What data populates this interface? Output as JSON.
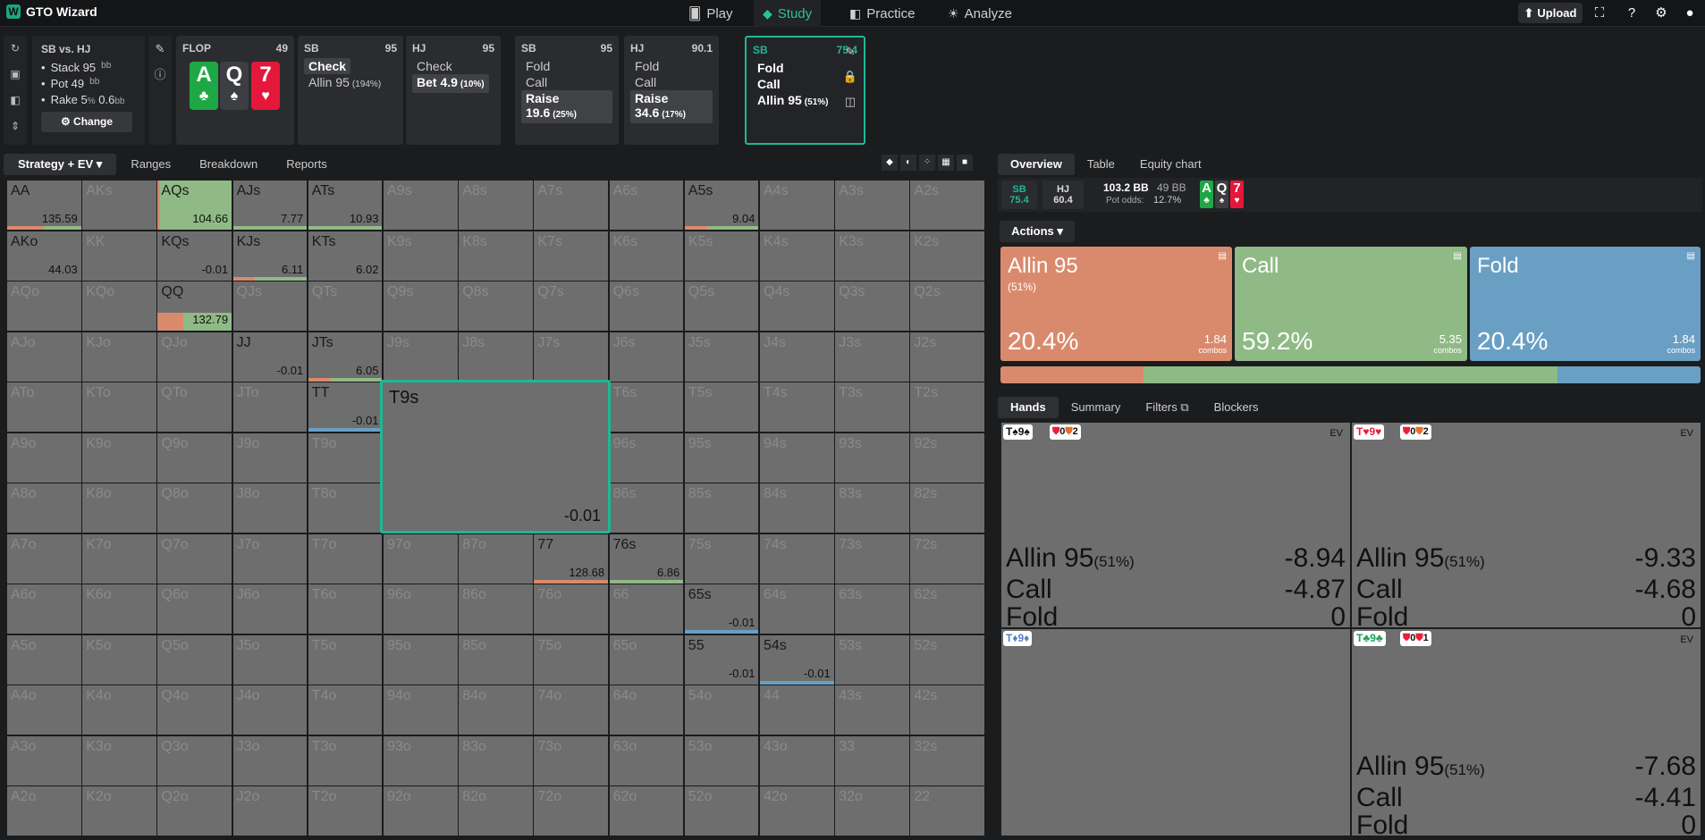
{
  "app": {
    "name": "GTO Wizard",
    "logo": "W"
  },
  "nav": [
    {
      "label": "Play",
      "icon": "cards-icon"
    },
    {
      "label": "Study",
      "icon": "graduation-cap-icon"
    },
    {
      "label": "Practice",
      "icon": "gamepad-icon"
    },
    {
      "label": "Analyze",
      "icon": "bulb-icon"
    }
  ],
  "upload_label": "Upload",
  "info": {
    "title": "SB vs. HJ",
    "stack": "Stack 95",
    "stack_unit": "bb",
    "pot": "Pot 49",
    "pot_unit": "bb",
    "rake": "Rake 5",
    "rake_pct": "%",
    "rake_val": "0.6",
    "rake_unit": "bb",
    "change": "Change"
  },
  "flop": {
    "label": "FLOP",
    "pot": "49",
    "cards": [
      {
        "rank": "A",
        "suit": "♣",
        "color": "#1ea845"
      },
      {
        "rank": "Q",
        "suit": "♠",
        "color": "#3d3e42"
      },
      {
        "rank": "7",
        "suit": "♥",
        "color": "#e5173a"
      }
    ]
  },
  "actions": [
    {
      "pos": "SB",
      "val": "95",
      "opts": [
        {
          "t": "Check",
          "p": "",
          "sel": true
        },
        {
          "t": "Allin 95",
          "p": "(194%)",
          "sel": false
        }
      ]
    },
    {
      "pos": "HJ",
      "val": "95",
      "opts": [
        {
          "t": "Check",
          "p": "",
          "sel": false
        },
        {
          "t": "Bet 4.9",
          "p": "(10%)",
          "sel": true
        }
      ]
    },
    {
      "pos": "SB",
      "val": "95",
      "opts": [
        {
          "t": "Fold",
          "p": "",
          "sel": false
        },
        {
          "t": "Call",
          "p": "",
          "sel": false
        },
        {
          "t": "Raise 19.6",
          "p": "(25%)",
          "sel": true
        }
      ]
    },
    {
      "pos": "HJ",
      "val": "90.1",
      "opts": [
        {
          "t": "Fold",
          "p": "",
          "sel": false
        },
        {
          "t": "Call",
          "p": "",
          "sel": false
        },
        {
          "t": "Raise 34.6",
          "p": "(17%)",
          "sel": true
        }
      ]
    },
    {
      "pos": "SB",
      "val": "75.4",
      "opts": [
        {
          "t": "Fold",
          "p": "",
          "sel": false
        },
        {
          "t": "Call",
          "p": "",
          "sel": false
        },
        {
          "t": "Allin 95",
          "p": "(51%)",
          "sel": false
        }
      ]
    }
  ],
  "left_tabs": [
    "Strategy + EV",
    "Ranges",
    "Breakdown",
    "Reports"
  ],
  "right_tabs": [
    "Overview",
    "Table",
    "Equity chart"
  ],
  "pos_summary": {
    "sb": "SB",
    "sb_val": "75.4",
    "hj": "HJ",
    "hj_val": "60.4",
    "pot": "103.2 BB",
    "pot2": "49 BB",
    "odds_label": "Pot odds:",
    "odds": "12.7%"
  },
  "actions_label": "Actions",
  "action_boxes": [
    {
      "name": "Allin 95",
      "sub": "(51%)",
      "pct": "20.4%",
      "combos": "1.84",
      "combos_label": "combos",
      "color": "#da8a6c"
    },
    {
      "name": "Call",
      "sub": "",
      "pct": "59.2%",
      "combos": "5.35",
      "combos_label": "combos",
      "color": "#8fba86"
    },
    {
      "name": "Fold",
      "sub": "",
      "pct": "20.4%",
      "combos": "1.84",
      "combos_label": "combos",
      "color": "#6a9fc4"
    }
  ],
  "freq": [
    {
      "f": 0.204,
      "color": "#da8a6c"
    },
    {
      "f": 0.592,
      "color": "#8fba86"
    },
    {
      "f": 0.204,
      "color": "#6a9fc4"
    }
  ],
  "hand_tabs": [
    "Hands",
    "Summary",
    "Filters",
    "Blockers"
  ],
  "hand_cells": [
    {
      "combo": [
        [
          "T",
          "♠",
          "#111"
        ],
        [
          "9",
          "♠",
          "#111"
        ]
      ],
      "blockers": [
        [
          "0",
          "#e8203a"
        ],
        [
          "2",
          "#e8702a"
        ]
      ],
      "ev": "EV",
      "rows": [
        [
          "Allin 95",
          "(51%)",
          "-8.94"
        ],
        [
          "Call",
          "",
          "-4.87"
        ],
        [
          "Fold",
          "",
          "0"
        ]
      ]
    },
    {
      "combo": [
        [
          "T",
          "♥",
          "#e8203a"
        ],
        [
          "9",
          "♥",
          "#e8203a"
        ]
      ],
      "blockers": [
        [
          "0",
          "#e8203a"
        ],
        [
          "2",
          "#e8702a"
        ]
      ],
      "ev": "EV",
      "rows": [
        [
          "Allin 95",
          "(51%)",
          "-9.33"
        ],
        [
          "Call",
          "",
          "-4.68"
        ],
        [
          "Fold",
          "",
          "0"
        ]
      ]
    },
    {
      "combo": [
        [
          "T",
          "♦",
          "#5b7fc4"
        ],
        [
          "9",
          "♦",
          "#5b7fc4"
        ]
      ],
      "blockers": [],
      "ev": "",
      "rows": []
    },
    {
      "combo": [
        [
          "T",
          "♣",
          "#1ea05a"
        ],
        [
          "9",
          "♣",
          "#1ea05a"
        ]
      ],
      "blockers": [
        [
          "0",
          "#e8203a"
        ],
        [
          "1",
          "#e8203a"
        ]
      ],
      "ev": "EV",
      "rows": [
        [
          "Allin 95",
          "(51%)",
          "-7.68"
        ],
        [
          "Call",
          "",
          "-4.41"
        ],
        [
          "Fold",
          "",
          "0"
        ]
      ]
    }
  ],
  "grid": {
    "ranks": [
      "A",
      "K",
      "Q",
      "J",
      "T",
      "9",
      "8",
      "7",
      "6",
      "5",
      "4",
      "3",
      "2"
    ],
    "active": {
      "AA": {
        "ev": "135.59",
        "bars": [
          [
            "#da8a6c",
            0.5
          ],
          [
            "#8fba86",
            0.5
          ]
        ]
      },
      "AQs": {
        "ev": "104.66",
        "bars": [],
        "fill": "#8fba86"
      },
      "AJs": {
        "ev": "7.77",
        "bars": [
          [
            "#8fba86",
            1
          ]
        ]
      },
      "ATs": {
        "ev": "10.93",
        "bars": [
          [
            "#8fba86",
            1
          ]
        ]
      },
      "A5s": {
        "ev": "9.04",
        "bars": [
          [
            "#da8a6c",
            0.3
          ],
          [
            "#8fba86",
            0.7
          ]
        ]
      },
      "AKo": {
        "ev": "44.03",
        "bars": []
      },
      "KQs": {
        "ev": "-0.01",
        "bars": []
      },
      "KJs": {
        "ev": "6.11",
        "bars": [
          [
            "#da8a6c",
            0.3
          ],
          [
            "#8fba86",
            0.7
          ]
        ]
      },
      "KTs": {
        "ev": "6.02",
        "bars": []
      },
      "QQ": {
        "ev": "132.79",
        "bars": [],
        "fill2": true
      },
      "JJ": {
        "ev": "-0.01",
        "bars": []
      },
      "JTs": {
        "ev": "6.05",
        "bars": [
          [
            "#da8a6c",
            0.3
          ],
          [
            "#8fba86",
            0.7
          ]
        ]
      },
      "TT": {
        "ev": "-0.01",
        "bars": [
          [
            "#6a9fc4",
            1
          ]
        ]
      },
      "77": {
        "ev": "128.68",
        "bars": [
          [
            "#da8a6c",
            1
          ]
        ]
      },
      "76s": {
        "ev": "6.86",
        "bars": [
          [
            "#8fba86",
            1
          ]
        ]
      },
      "65s": {
        "ev": "-0.01",
        "bars": [
          [
            "#6a9fc4",
            1
          ]
        ]
      },
      "55": {
        "ev": "-0.01",
        "bars": []
      },
      "54s": {
        "ev": "-0.01",
        "bars": [
          [
            "#6a9fc4",
            1
          ]
        ]
      }
    },
    "zoom": {
      "label": "T9s",
      "ev": "-0.01"
    }
  }
}
